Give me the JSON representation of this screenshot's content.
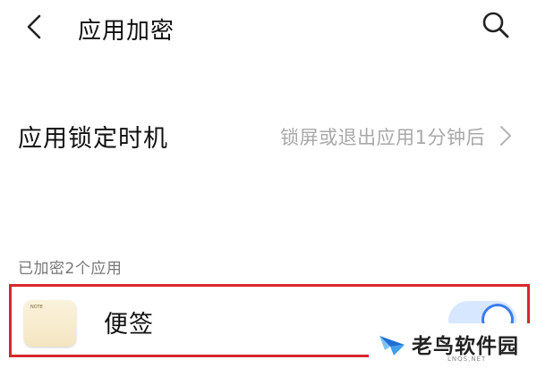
{
  "header": {
    "title": "应用加密"
  },
  "lock_timing": {
    "label": "应用锁定时机",
    "value": "锁屏或退出应用1分钟后"
  },
  "encrypted_section": {
    "label": "已加密2个应用",
    "apps": [
      {
        "name": "便签",
        "icon_text": "NOTE",
        "enabled": true
      }
    ]
  },
  "watermark": {
    "text": "老鸟软件园",
    "sub": "LNQS.NET"
  },
  "colors": {
    "highlight_border": "#d9262f",
    "toggle_accent": "#3b7cf0",
    "secondary_text": "#a8a8a8"
  }
}
